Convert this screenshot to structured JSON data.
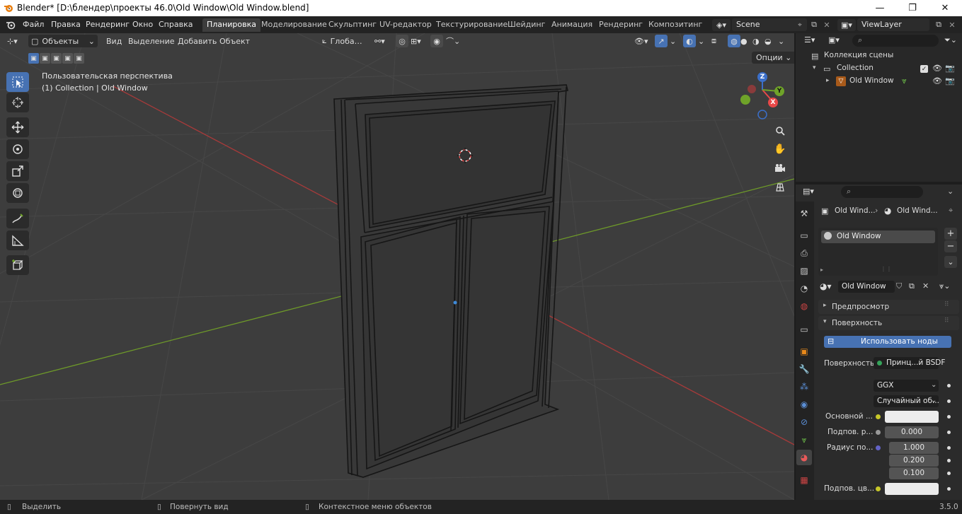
{
  "titlebar": {
    "title": "Blender* [D:\\блендер\\проекты 46.0\\Old Window\\Old Window.blend]",
    "minimize": "—",
    "maximize": "❐",
    "close": "✕"
  },
  "menu": [
    "Файл",
    "Правка",
    "Рендеринг",
    "Окно",
    "Справка"
  ],
  "workspaces": [
    "Планировка",
    "Моделирование",
    "Скульптинг",
    "UV-редактор",
    "Текстурирование",
    "Шейдинг",
    "Анимация",
    "Рендеринг",
    "Композитинг"
  ],
  "active_workspace": "Планировка",
  "scene": {
    "name": "Scene",
    "view_layer": "ViewLayer"
  },
  "viewport_header": {
    "mode": "Объекты",
    "menus": [
      "Вид",
      "Выделение",
      "Добавить",
      "Объект"
    ],
    "transform_orientation": "Глоба…",
    "options": "Опции"
  },
  "viewport": {
    "view_name": "Пользовательская перспектива",
    "context": "(1) Collection | Old Window",
    "gizmo_axes": {
      "x": "X",
      "y": "Y",
      "z": "Z"
    }
  },
  "outliner": {
    "root": "Коллекция сцены",
    "collection": "Collection",
    "object": "Old Window"
  },
  "properties": {
    "breadcrumb": [
      "Old Wind...",
      "Old Wind..."
    ],
    "material_slot": "Old Window",
    "material_name": "Old Window",
    "panels": {
      "preview": "Предпросмотр",
      "surface": "Поверхность"
    },
    "use_nodes_button": "Использовать ноды",
    "surface_label": "Поверхность",
    "surface_shader": "Принц...й BSDF",
    "distribution": "GGX",
    "subsurface_method": "Случайный об...",
    "rows": [
      {
        "label": "Основной ...",
        "value": ""
      },
      {
        "label": "Подпов. р...",
        "value": "0.000"
      },
      {
        "label": "Радиус по...",
        "value": "1.000"
      },
      {
        "label": "",
        "value": "0.200"
      },
      {
        "label": "",
        "value": "0.100"
      },
      {
        "label": "Подпов. цв...",
        "value": ""
      }
    ]
  },
  "statusbar": {
    "select": "Выделить",
    "rotate": "Повернуть вид",
    "context_menu": "Контекстное меню объектов",
    "version": "3.5.0"
  },
  "colors": {
    "accent": "#4772b3",
    "x_axis": "#a83a3a",
    "y_axis": "#6e9a29",
    "viewport_bg": "#3d3d3d"
  }
}
